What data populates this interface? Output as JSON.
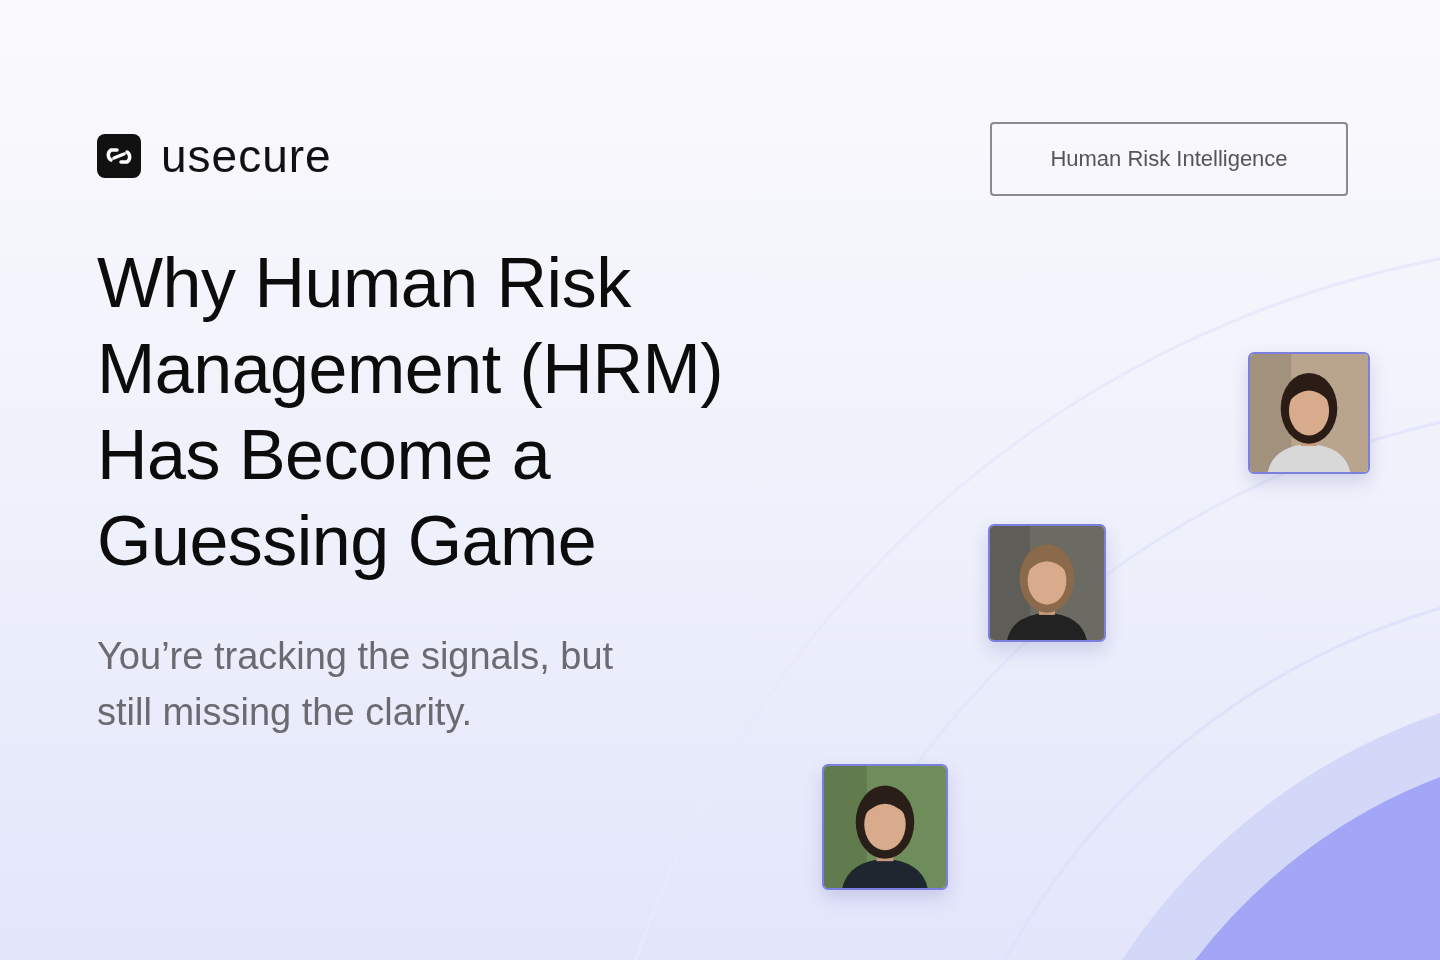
{
  "logo": {
    "text": "usecure"
  },
  "badge": {
    "label": "Human Risk Intelligence"
  },
  "headline": {
    "lines": [
      "Why Human Risk",
      "Management (HRM)",
      "Has Become a",
      "Guessing Game"
    ]
  },
  "subtitle": {
    "lines": [
      "You’re tracking the signals, but",
      "still missing the clarity."
    ]
  }
}
